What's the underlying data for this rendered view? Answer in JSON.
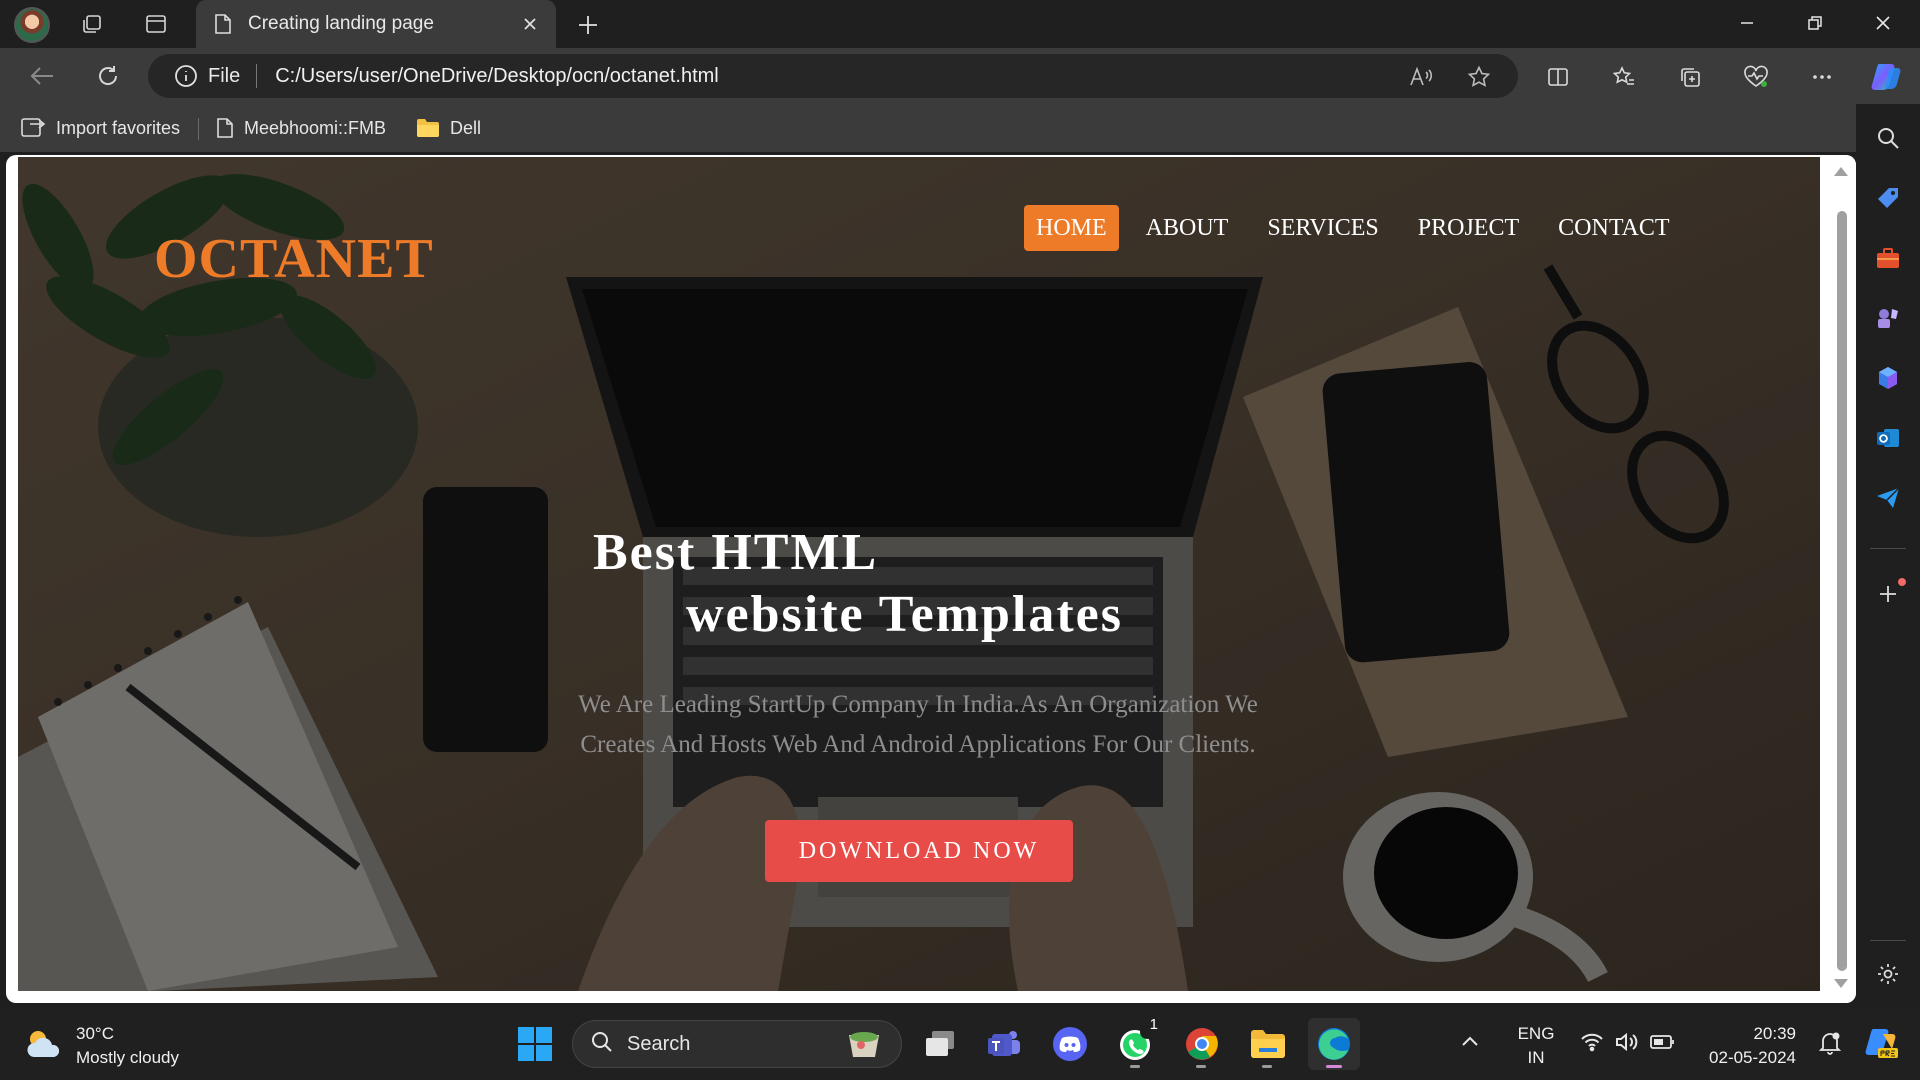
{
  "browser": {
    "tab": {
      "title": "Creating landing page"
    },
    "address": {
      "scheme_label": "File",
      "url": "C:/Users/user/OneDrive/Desktop/ocn/octanet.html"
    },
    "favorites": [
      {
        "label": "Import favorites",
        "icon": "import-icon"
      },
      {
        "label": "Meebhoomi::FMB",
        "icon": "page-icon"
      },
      {
        "label": "Dell",
        "icon": "folder-icon"
      }
    ]
  },
  "site": {
    "logo": "OCTANET",
    "logo_color": "#ee7b27",
    "nav": [
      {
        "label": "HOME",
        "active": true
      },
      {
        "label": "ABOUT",
        "active": false
      },
      {
        "label": "SERVICES",
        "active": false
      },
      {
        "label": "PROJECT",
        "active": false
      },
      {
        "label": "CONTACT",
        "active": false
      }
    ],
    "nav_active_color": "#ee7b27",
    "headline_line1": "Best HTML",
    "headline_line2": "website Templates",
    "tagline_line1": "We Are Leading StartUp Company In India.As An Organization We",
    "tagline_line2": "Creates And Hosts Web And Android Applications For Our Clients.",
    "cta": "DOWNLOAD NOW",
    "cta_color": "#e84c48"
  },
  "taskbar": {
    "weather_temp": "30°C",
    "weather_desc": "Mostly cloudy",
    "search_label": "Search",
    "whatsapp_badge": "1",
    "language_line1": "ENG",
    "language_line2": "IN",
    "time": "20:39",
    "date": "02-05-2024"
  }
}
